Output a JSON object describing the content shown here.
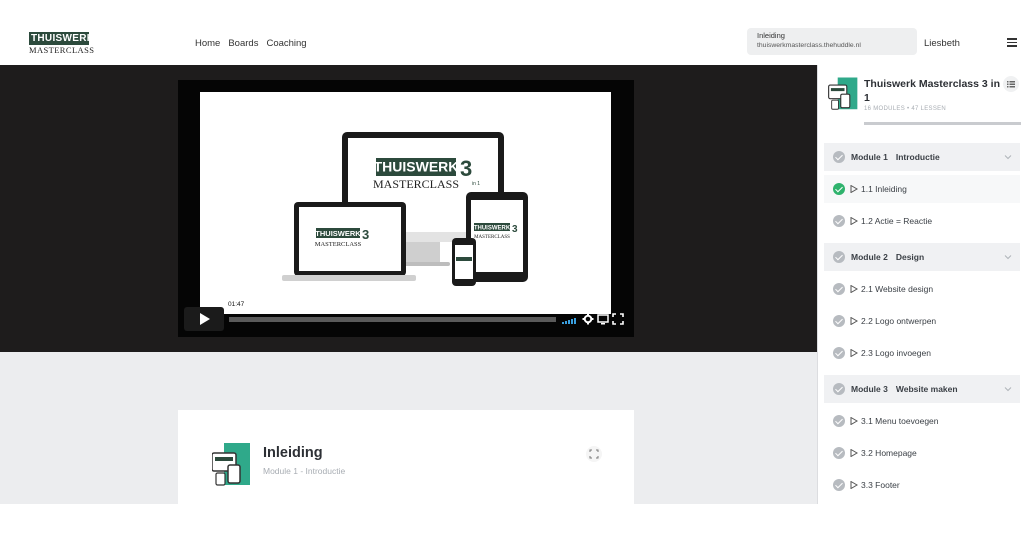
{
  "brand": {
    "logo_top": "THUISWERK",
    "logo_bottom": "MASTERCLASS"
  },
  "nav": [
    {
      "label": "Home"
    },
    {
      "label": "Boards"
    },
    {
      "label": "Coaching"
    }
  ],
  "notification": {
    "title": "Inleiding",
    "url": "thuiswerkmasterclass.thehuddle.nl"
  },
  "user": {
    "name": "Liesbeth"
  },
  "video": {
    "timestamp": "01:47",
    "progress": 0.0,
    "poster_brand_top": "THUISWERK",
    "poster_brand_num": "3",
    "poster_brand_bottom": "MASTERCLASS",
    "poster_in1": "in 1"
  },
  "lesson": {
    "title": "Inleiding",
    "subtitle": "Module 1 - Introductie"
  },
  "course": {
    "title": "Thuiswerk Masterclass 3 in 1",
    "meta": "16 MODULES  •  47 LESSEN",
    "accent": "#2fb36d"
  },
  "sidebar": {
    "modules": [
      {
        "label": "Module 1",
        "name": "Introductie"
      },
      {
        "label": "Module 2",
        "name": "Design"
      },
      {
        "label": "Module 3",
        "name": "Website maken"
      }
    ],
    "lessons": [
      {
        "label": "1.1 Inleiding",
        "done": true
      },
      {
        "label": "1.2 Actie = Reactie",
        "done": false
      },
      {
        "label": "2.1 Website design",
        "done": false
      },
      {
        "label": "2.2 Logo ontwerpen",
        "done": false
      },
      {
        "label": "2.3 Logo invoegen",
        "done": false
      },
      {
        "label": "3.1 Menu toevoegen",
        "done": false
      },
      {
        "label": "3.2 Homepage",
        "done": false
      },
      {
        "label": "3.3 Footer",
        "done": false
      }
    ]
  }
}
